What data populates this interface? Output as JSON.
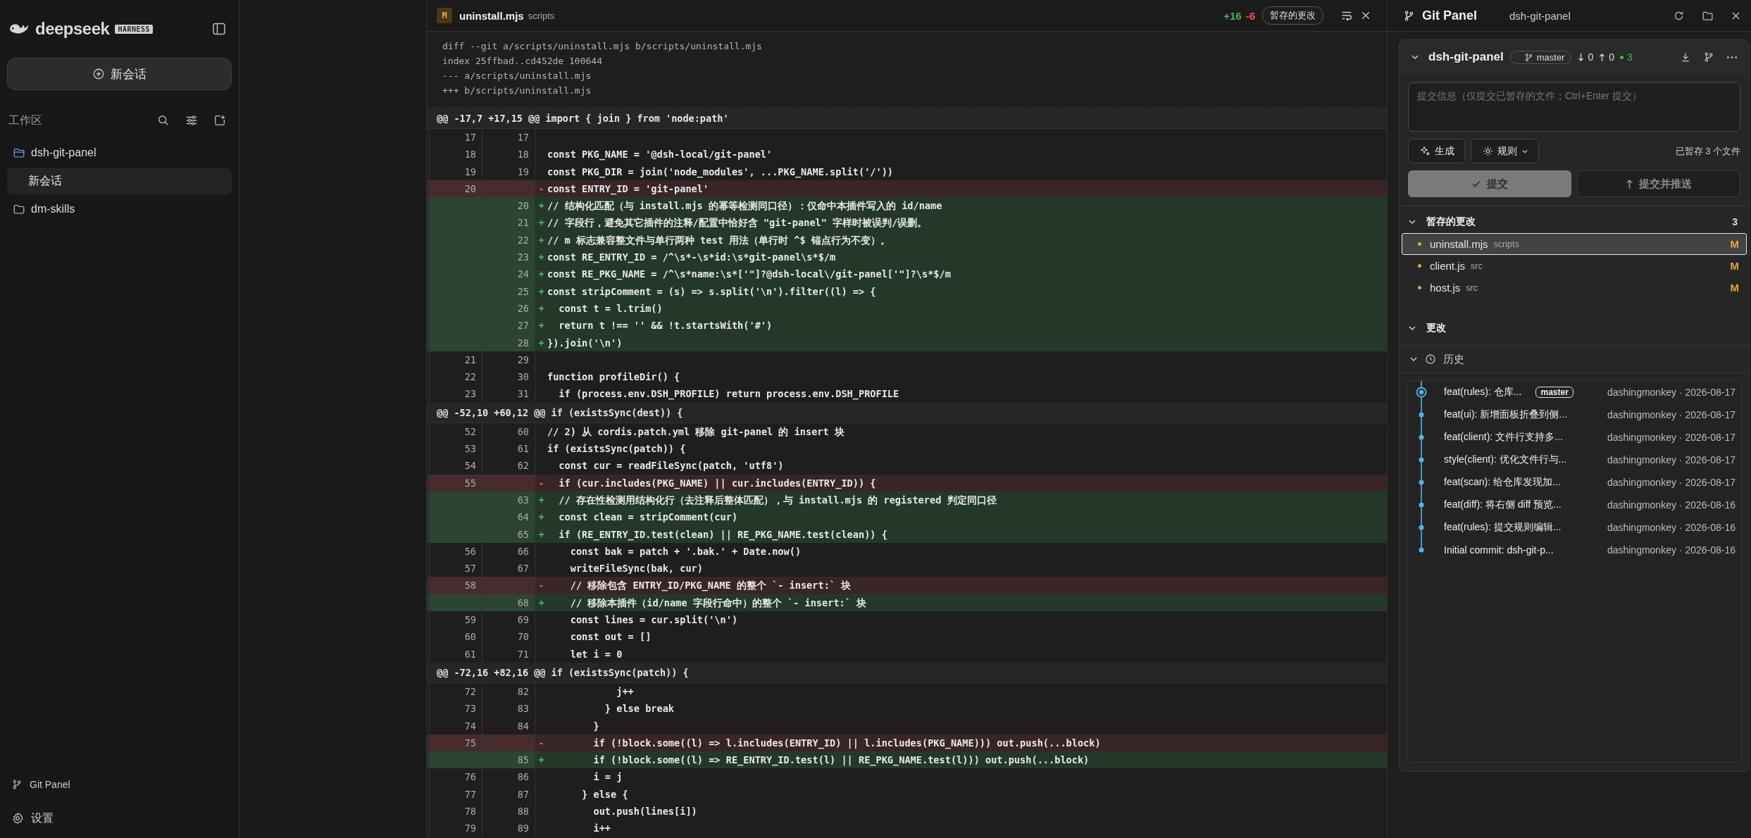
{
  "sidebar": {
    "brand": "deepseek",
    "brand_badge": "HARNESS",
    "new_button": "新会话",
    "workspace_label": "工作区",
    "tree": [
      {
        "name": "dsh-git-panel",
        "expanded": true,
        "children": [
          {
            "name": "新会话",
            "selected": true
          }
        ]
      },
      {
        "name": "dm-skills",
        "expanded": false
      }
    ],
    "footer": [
      {
        "kind": "git",
        "label": "Git Panel"
      },
      {
        "kind": "settings",
        "label": "设置"
      }
    ]
  },
  "diff": {
    "status": "M",
    "file": "uninstall.mjs",
    "dir": "scripts",
    "added": "+16",
    "removed": "-6",
    "stage_button": "暂存的更改",
    "meta": [
      "diff --git a/scripts/uninstall.mjs b/scripts/uninstall.mjs",
      "index 25ffbad..cd452de 100644",
      "--- a/scripts/uninstall.mjs",
      "+++ b/scripts/uninstall.mjs"
    ],
    "hunks": [
      {
        "header": "@@ -17,7 +17,15 @@ import { join } from 'node:path'",
        "rows": [
          {
            "kind": "ctx",
            "old": "17",
            "new": "17"
          },
          {
            "kind": "ctx",
            "old": "18",
            "new": "18",
            "code": "const PKG_NAME = '@dsh-local/git-panel'"
          },
          {
            "kind": "ctx",
            "old": "19",
            "new": "19",
            "code": "const PKG_DIR = join('node_modules', ...PKG_NAME.split('/'))"
          },
          {
            "kind": "del",
            "old": "20",
            "sign": "-",
            "code": "const ENTRY_ID = 'git-panel'"
          },
          {
            "kind": "add",
            "new": "20",
            "sign": "+",
            "code": "// 结构化匹配（与 install.mjs 的幂等检测同口径）：仅命中本插件写入的 id/name"
          },
          {
            "kind": "add",
            "new": "21",
            "sign": "+",
            "code": "// 字段行，避免其它插件的注释/配置中恰好含 \"git-panel\" 字样时被误判/误删。"
          },
          {
            "kind": "add",
            "new": "22",
            "sign": "+",
            "code": "// m 标志兼容整文件与单行两种 test 用法（单行时 ^$ 锚点行为不变）。"
          },
          {
            "kind": "add",
            "new": "23",
            "sign": "+",
            "code": "const RE_ENTRY_ID = /^\\s*-\\s*id:\\s*git-panel\\s*$/m"
          },
          {
            "kind": "add",
            "new": "24",
            "sign": "+",
            "code": "const RE_PKG_NAME = /^\\s*name:\\s*['\"]?@dsh-local\\/git-panel['\"]?\\s*$/m"
          },
          {
            "kind": "add",
            "new": "25",
            "sign": "+",
            "code": "const stripComment = (s) => s.split('\\n').filter((l) => {"
          },
          {
            "kind": "add",
            "new": "26",
            "sign": "+",
            "code": "  const t = l.trim()"
          },
          {
            "kind": "add",
            "new": "27",
            "sign": "+",
            "code": "  return t !== '' && !t.startsWith('#')"
          },
          {
            "kind": "add",
            "new": "28",
            "sign": "+",
            "code": "}).join('\\n')"
          },
          {
            "kind": "ctx",
            "old": "21",
            "new": "29"
          },
          {
            "kind": "ctx",
            "old": "22",
            "new": "30",
            "code": "function profileDir() {"
          },
          {
            "kind": "ctx",
            "old": "23",
            "new": "31",
            "code": "  if (process.env.DSH_PROFILE) return process.env.DSH_PROFILE"
          }
        ]
      },
      {
        "header": "@@ -52,10 +60,12 @@ if (existsSync(dest)) {",
        "rows": [
          {
            "kind": "ctx",
            "old": "52",
            "new": "60",
            "code": "// 2) 从 cordis.patch.yml 移除 git-panel 的 insert 块"
          },
          {
            "kind": "ctx",
            "old": "53",
            "new": "61",
            "code": "if (existsSync(patch)) {"
          },
          {
            "kind": "ctx",
            "old": "54",
            "new": "62",
            "code": "  const cur = readFileSync(patch, 'utf8')"
          },
          {
            "kind": "del",
            "old": "55",
            "sign": "-",
            "code": "  if (cur.includes(PKG_NAME) || cur.includes(ENTRY_ID)) {"
          },
          {
            "kind": "add",
            "new": "63",
            "sign": "+",
            "code": "  // 存在性检测用结构化行（去注释后整体匹配），与 install.mjs 的 registered 判定同口径"
          },
          {
            "kind": "add",
            "new": "64",
            "sign": "+",
            "code": "  const clean = stripComment(cur)"
          },
          {
            "kind": "add",
            "new": "65",
            "sign": "+",
            "code": "  if (RE_ENTRY_ID.test(clean) || RE_PKG_NAME.test(clean)) {"
          },
          {
            "kind": "ctx",
            "old": "56",
            "new": "66",
            "code": "    const bak = patch + '.bak.' + Date.now()"
          },
          {
            "kind": "ctx",
            "old": "57",
            "new": "67",
            "code": "    writeFileSync(bak, cur)"
          },
          {
            "kind": "del",
            "old": "58",
            "sign": "-",
            "code": "    // 移除包含 ENTRY_ID/PKG_NAME 的整个 `- insert:` 块"
          },
          {
            "kind": "add",
            "new": "68",
            "sign": "+",
            "code": "    // 移除本插件（id/name 字段行命中）的整个 `- insert:` 块"
          },
          {
            "kind": "ctx",
            "old": "59",
            "new": "69",
            "code": "    const lines = cur.split('\\n')"
          },
          {
            "kind": "ctx",
            "old": "60",
            "new": "70",
            "code": "    const out = []"
          },
          {
            "kind": "ctx",
            "old": "61",
            "new": "71",
            "code": "    let i = 0"
          }
        ]
      },
      {
        "header": "@@ -72,16 +82,16 @@ if (existsSync(patch)) {",
        "rows": [
          {
            "kind": "ctx",
            "old": "72",
            "new": "82",
            "code": "            j++"
          },
          {
            "kind": "ctx",
            "old": "73",
            "new": "83",
            "code": "          } else break"
          },
          {
            "kind": "ctx",
            "old": "74",
            "new": "84",
            "code": "        }"
          },
          {
            "kind": "del",
            "old": "75",
            "sign": "-",
            "code": "        if (!block.some((l) => l.includes(ENTRY_ID) || l.includes(PKG_NAME))) out.push(...block)"
          },
          {
            "kind": "add",
            "new": "85",
            "sign": "+",
            "code": "        if (!block.some((l) => RE_ENTRY_ID.test(l) || RE_PKG_NAME.test(l))) out.push(...block)"
          },
          {
            "kind": "ctx",
            "old": "76",
            "new": "86",
            "code": "        i = j"
          },
          {
            "kind": "ctx",
            "old": "77",
            "new": "87",
            "code": "      } else {"
          },
          {
            "kind": "ctx",
            "old": "78",
            "new": "88",
            "code": "        out.push(lines[i])"
          },
          {
            "kind": "ctx",
            "old": "79",
            "new": "89",
            "code": "        i++"
          }
        ]
      }
    ]
  },
  "git_panel": {
    "title": "Git Panel",
    "repo_label": "dsh-git-panel",
    "repo": {
      "name": "dsh-git-panel",
      "expanded": true,
      "branch": "master",
      "behind": "0",
      "ahead": "0",
      "staged": "3"
    },
    "commit_placeholder": "提交信息（仅提交已暂存的文件；Ctrl+Enter 提交）",
    "generate": "生成",
    "rules": "规则",
    "staged_summary": "已暂存 3 个文件",
    "commit": "提交",
    "commit_push": "提交并推送",
    "sections": [
      {
        "title": "暂存的更改",
        "count": "3",
        "expanded": true,
        "files": [
          {
            "name": "uninstall.mjs",
            "dir": "scripts",
            "status": "M",
            "selected": true
          },
          {
            "name": "client.js",
            "dir": "src",
            "status": "M",
            "selected": false
          },
          {
            "name": "host.js",
            "dir": "src",
            "status": "M",
            "selected": false
          }
        ]
      },
      {
        "title": "更改",
        "expanded": true
      }
    ],
    "history": {
      "title": "历史",
      "expanded": true,
      "commits": [
        {
          "message": "feat(rules): 仓库...",
          "ref": "master",
          "meta": "dashingmonkey · 2026-08-17",
          "head": true
        },
        {
          "message": "feat(ui): 新增面板折叠到侧...",
          "meta": "dashingmonkey · 2026-08-17",
          "head": false
        },
        {
          "message": "feat(client): 文件行支持多...",
          "meta": "dashingmonkey · 2026-08-17",
          "head": false
        },
        {
          "message": "style(client): 优化文件行与...",
          "meta": "dashingmonkey · 2026-08-17",
          "head": false
        },
        {
          "message": "feat(scan): 给仓库发现加...",
          "meta": "dashingmonkey · 2026-08-17",
          "head": false
        },
        {
          "message": "feat(diff): 将右侧 diff 预览...",
          "meta": "dashingmonkey · 2026-08-16",
          "head": false
        },
        {
          "message": "feat(rules): 提交规则编辑...",
          "meta": "dashingmonkey · 2026-08-16",
          "head": false
        },
        {
          "message": "Initial commit: dsh-git-p...",
          "meta": "dashingmonkey · 2026-08-16",
          "head": false
        }
      ]
    }
  }
}
